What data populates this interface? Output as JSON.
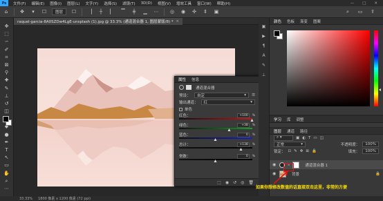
{
  "menu": {
    "app_badge": "Ps",
    "items": [
      "文件(F)",
      "编辑(E)",
      "图像(I)",
      "图层(L)",
      "文字(Y)",
      "选择(S)",
      "滤镜(T)",
      "3D(D)",
      "视图(V)",
      "增效工具",
      "窗口(W)",
      "帮助(H)"
    ],
    "win_controls": [
      "—",
      "□",
      "✕"
    ]
  },
  "options": {
    "mode_label": "图层"
  },
  "document": {
    "tab_title": "raquel-garcia-8A0SZDw4LgE-unsplash (1).jpg @ 33.3% (通道混合器 1, 图层蒙版/8) *",
    "close": "×"
  },
  "status": {
    "zoom": "33.33%",
    "info": "1800 像素 x 1200 像素 (72 ppi)"
  },
  "properties": {
    "tabs": [
      "属性",
      "信息"
    ],
    "title": "通道混合器",
    "preset_label": "预设：",
    "preset_value": "自定",
    "output_label": "输出通道：",
    "output_value": "红",
    "mono_label": "单色",
    "sliders": [
      {
        "label": "红色：",
        "value": "+100",
        "pos": 1.0,
        "color": "#d01010"
      },
      {
        "label": "绿色：",
        "value": "+38",
        "pos": 0.69,
        "color": "#10a020"
      },
      {
        "label": "蓝色：",
        "value": "0",
        "pos": 0.5,
        "color": "#1020d0"
      },
      {
        "label": "总计：",
        "value": "+138",
        "pos": 0.85,
        "color": "#000000"
      },
      {
        "label": "常数：",
        "value": "0",
        "pos": 0.5,
        "color": "#000000"
      }
    ],
    "pct": "%"
  },
  "panels": {
    "color_tabs": [
      "颜色",
      "色板",
      "渐变",
      "图案"
    ],
    "learn_tabs": [
      "学习",
      "库",
      "调整"
    ],
    "layers_tabs": [
      "图层",
      "通道",
      "路径"
    ],
    "kind_label": "正常",
    "opacity_label": "不透明度：",
    "opacity_value": "100%",
    "lock_label": "锁定：",
    "fill_label": "填充：",
    "fill_value": "100%",
    "layers": [
      {
        "name": "通道混合器 1",
        "selected": true
      },
      {
        "name": "背景",
        "selected": false
      }
    ]
  },
  "caption": "如果你想修改数值的话直接双击这里，非常的方便",
  "colors": {
    "accent": "#31a8ff",
    "caption": "#ffe000",
    "highlight": "#e11111"
  }
}
